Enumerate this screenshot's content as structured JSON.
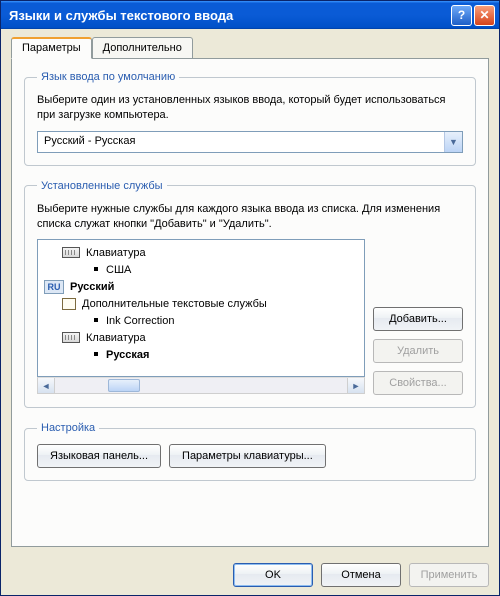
{
  "window": {
    "title": "Языки и службы текстового ввода"
  },
  "tabs": {
    "params": "Параметры",
    "advanced": "Дополнительно"
  },
  "defaultLanguage": {
    "legend": "Язык ввода по умолчанию",
    "desc": "Выберите один из установленных языков ввода, который будет использоваться при загрузке компьютера.",
    "selected": "Русский - Русская"
  },
  "installed": {
    "legend": "Установленные службы",
    "desc": "Выберите нужные службы для каждого языка ввода из списка. Для изменения списка служат кнопки \"Добавить\" и \"Удалить\".",
    "tree": {
      "keyboardCat": "Клавиатура",
      "usa": "США",
      "ruBadge": "RU",
      "ruLang": "Русский",
      "extraServices": "Дополнительные текстовые службы",
      "ink": "Ink Correction",
      "keyboardCat2": "Клавиатура",
      "ruLayout": "Русская"
    },
    "buttons": {
      "add": "Добавить...",
      "remove": "Удалить",
      "properties": "Свойства..."
    }
  },
  "settings": {
    "legend": "Настройка",
    "langbar": "Языковая панель...",
    "keyboard": "Параметры клавиатуры..."
  },
  "dialog": {
    "ok": "OK",
    "cancel": "Отмена",
    "apply": "Применить"
  }
}
